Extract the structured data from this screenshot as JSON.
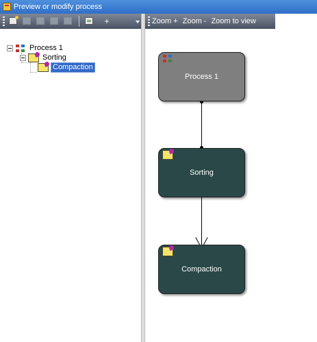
{
  "window": {
    "title": "Preview or modify process"
  },
  "left_toolbar": {
    "buttons": [
      {
        "icon": "new-process-icon",
        "enabled": true
      },
      {
        "icon": "copy-icon",
        "enabled": false
      },
      {
        "icon": "cut-icon",
        "enabled": false
      },
      {
        "icon": "paste-icon",
        "enabled": false
      },
      {
        "icon": "undo-icon",
        "enabled": false
      },
      {
        "icon": "add-step-icon",
        "enabled": true
      }
    ],
    "plus_label": "+"
  },
  "tree": {
    "root": {
      "label": "Process 1",
      "icon": "process-icon",
      "expanded": true
    },
    "child": {
      "label": "Sorting",
      "icon": "step-icon",
      "expanded": true
    },
    "grandchild": {
      "label": "Compaction",
      "icon": "step-icon",
      "selected": true
    }
  },
  "right_toolbar": {
    "zoom_in": "Zoom +",
    "zoom_out": "Zoom -",
    "zoom_to_view": "Zoom to view"
  },
  "diagram": {
    "nodes": [
      {
        "label": "Process 1",
        "icon": "process-icon",
        "color": "#7f7f7f"
      },
      {
        "label": "Sorting",
        "icon": "step-icon",
        "color": "#2a4848"
      },
      {
        "label": "Compaction",
        "icon": "step-icon",
        "color": "#2a4848"
      }
    ]
  },
  "colors": {
    "title_bar": "#2f6fc7",
    "toolbar": "#5a6272",
    "selection": "#3169c6"
  }
}
